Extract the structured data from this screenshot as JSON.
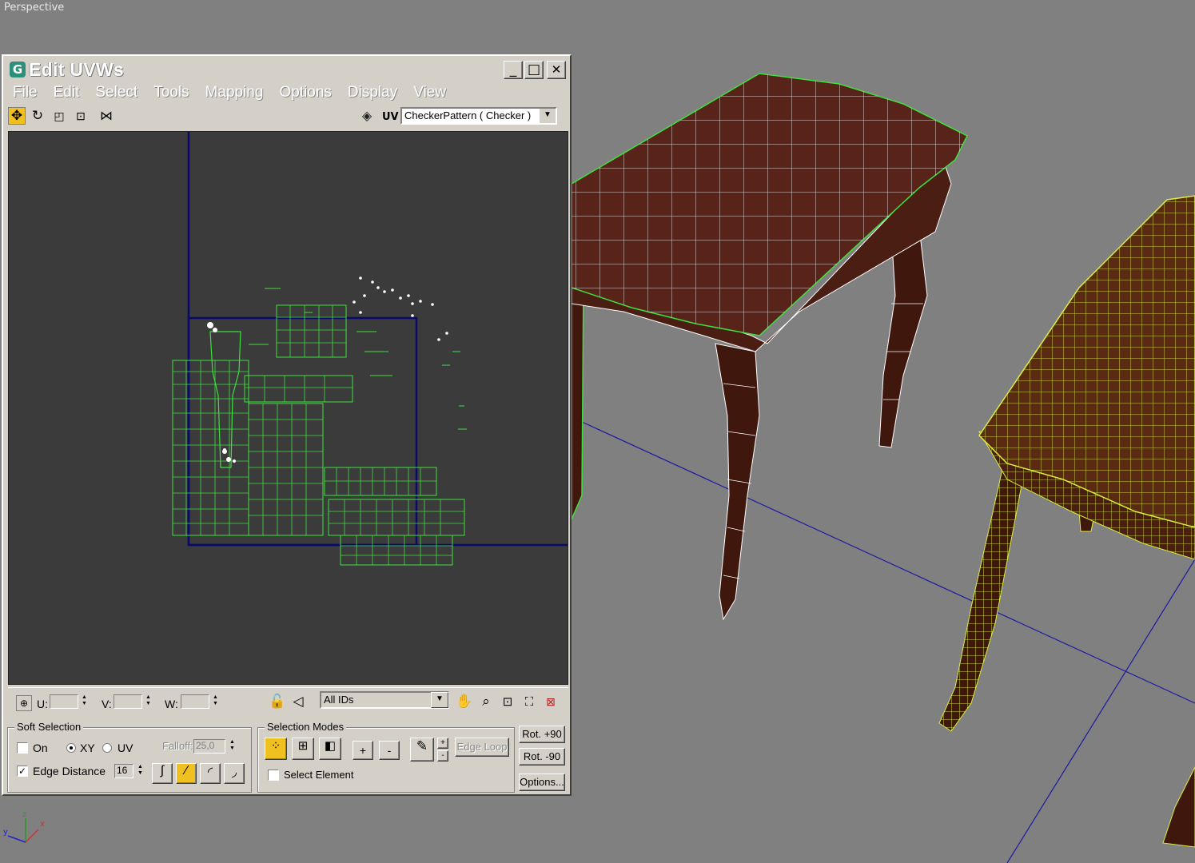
{
  "viewport": {
    "label": "Perspective",
    "axis": {
      "x": "x",
      "y": "y",
      "z": "z"
    }
  },
  "window": {
    "title": "Edit UVWs",
    "minimize": "_",
    "maximize": "□",
    "close": "✕"
  },
  "menu": {
    "items": [
      "File",
      "Edit",
      "Select",
      "Tools",
      "Mapping",
      "Options",
      "Display",
      "View"
    ]
  },
  "toolbar": {
    "uv_label": "UV",
    "texture": "CheckerPattern  ( Checker )"
  },
  "bottombar": {
    "u_label": "U:",
    "v_label": "V:",
    "w_label": "W:",
    "u_value": "",
    "v_value": "",
    "w_value": "",
    "ids": "All IDs"
  },
  "soft_selection": {
    "title": "Soft Selection",
    "on_label": "On",
    "on_checked": false,
    "xy_label": "XY",
    "uv_label": "UV",
    "mode": "XY",
    "falloff_label": "Falloff:",
    "falloff_value": "25,0",
    "edge_distance_label": "Edge Distance",
    "edge_distance_checked": true,
    "edge_distance_value": "16"
  },
  "selection_modes": {
    "title": "Selection Modes",
    "plus": "+",
    "minus": "-",
    "edge_loop": "Edge Loop",
    "select_element": "Select Element",
    "select_element_checked": false
  },
  "rotate": {
    "rot_plus": "Rot. +90",
    "rot_minus": "Rot. -90",
    "options": "Options..."
  },
  "colors": {
    "uv_wire": "#3ee03e",
    "uv_bg": "#3b3b3b",
    "uv_frame": "#0a0a6e",
    "wood": "#4a1e12",
    "selected_wire": "#d8f040",
    "viewport_bg": "#808080"
  }
}
